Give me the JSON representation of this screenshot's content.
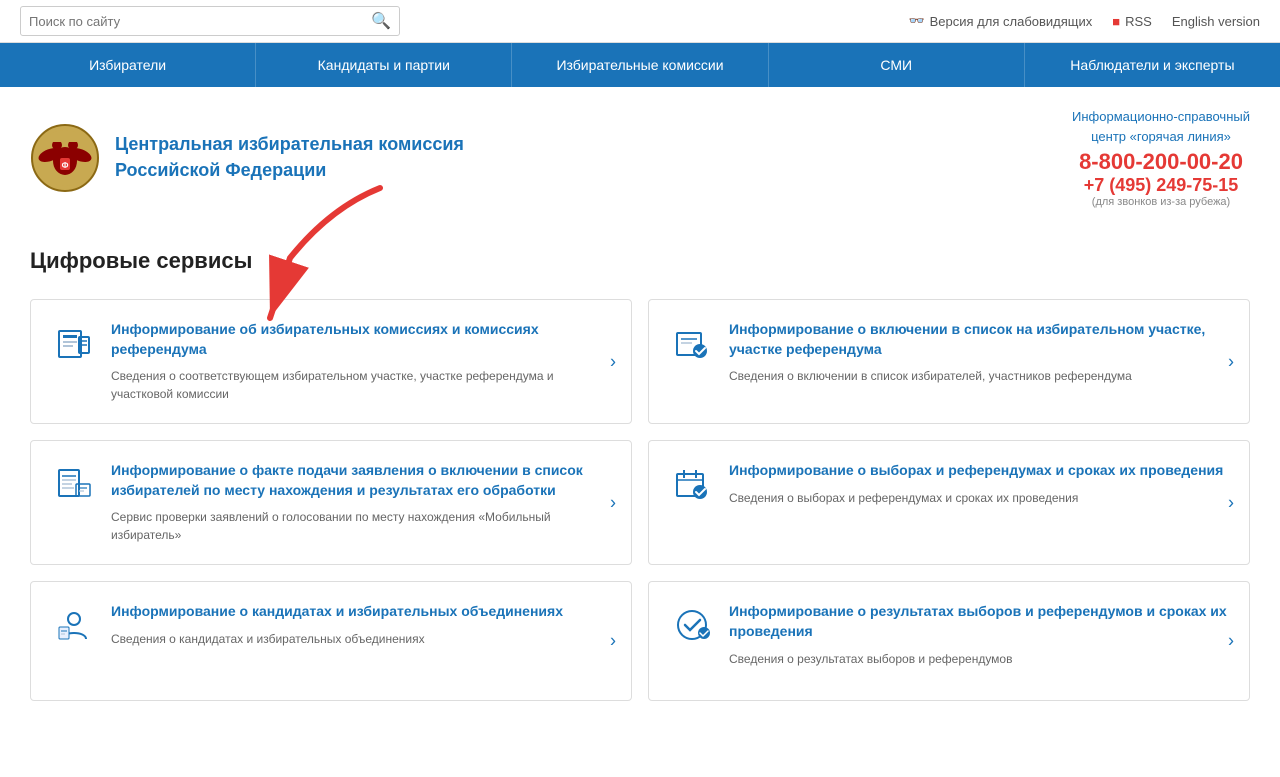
{
  "topbar": {
    "search_placeholder": "Поиск по сайту",
    "vision_label": "Версия для слабовидящих",
    "rss_label": "RSS",
    "english_label": "English version"
  },
  "nav": {
    "items": [
      "Избиратели",
      "Кандидаты и партии",
      "Избирательные комиссии",
      "СМИ",
      "Наблюдатели и эксперты"
    ]
  },
  "header": {
    "org_line1": "Центральная избирательная комиссия",
    "org_line2": "Российской Федерации",
    "hotline_title_line1": "Информационно-справочный",
    "hotline_title_line2": "центр «горячая линия»",
    "hotline_number1": "8-800-200-00-20",
    "hotline_number2": "+7 (495) 249-75-15",
    "hotline_note": "(для звонков из-за рубежа)"
  },
  "main": {
    "section_title": "Цифровые сервисы",
    "cards": [
      {
        "id": "card1",
        "title": "Информирование об избирательных комиссиях и комиссиях референдума",
        "desc": "Сведения о соответствующем избирательном участке, участке референдума и участковой комиссии"
      },
      {
        "id": "card2",
        "title": "Информирование о включении в список на избирательном участке, участке референдума",
        "desc": "Сведения о включении в список избирателей, участников референдума"
      },
      {
        "id": "card3",
        "title": "Информирование о факте подачи заявления о включении в список избирателей по месту нахождения и результатах его обработки",
        "desc": "Сервис проверки заявлений о голосовании по месту нахождения «Мобильный избиратель»"
      },
      {
        "id": "card4",
        "title": "Информирование о выборах и референдумах и сроках их проведения",
        "desc": "Сведения о выборах и референдумах и сроках их проведения"
      },
      {
        "id": "card5",
        "title": "Информирование о кандидатах и избирательных объединениях",
        "desc": "Сведения о кандидатах и избирательных объединениях"
      },
      {
        "id": "card6",
        "title": "Информирование о результатах выборов и референдумов и сроках их проведения",
        "desc": "Сведения о результатах выборов и референдумов"
      }
    ]
  },
  "colors": {
    "primary": "#1a73b8",
    "accent": "#e53935",
    "nav_bg": "#1a73b8"
  }
}
